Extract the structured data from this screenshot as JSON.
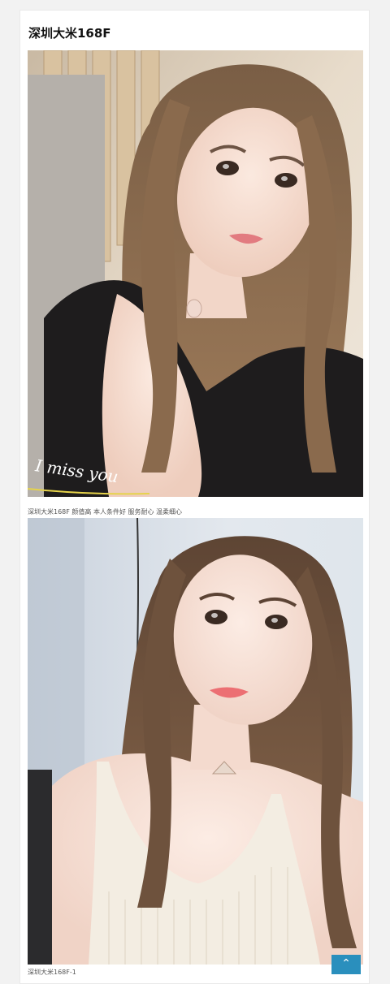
{
  "post": {
    "title": "深圳大米168F"
  },
  "photos": [
    {
      "caption": "深圳大米168F 颜值高 本人条件好 服务耐心 温柔细心",
      "overlay_text": "I miss you"
    },
    {
      "caption": "深圳大米168F-1"
    }
  ],
  "back_to_top": {
    "icon": "chevron-up-icon",
    "glyph": "⌃",
    "color": "#2a8fbd"
  }
}
